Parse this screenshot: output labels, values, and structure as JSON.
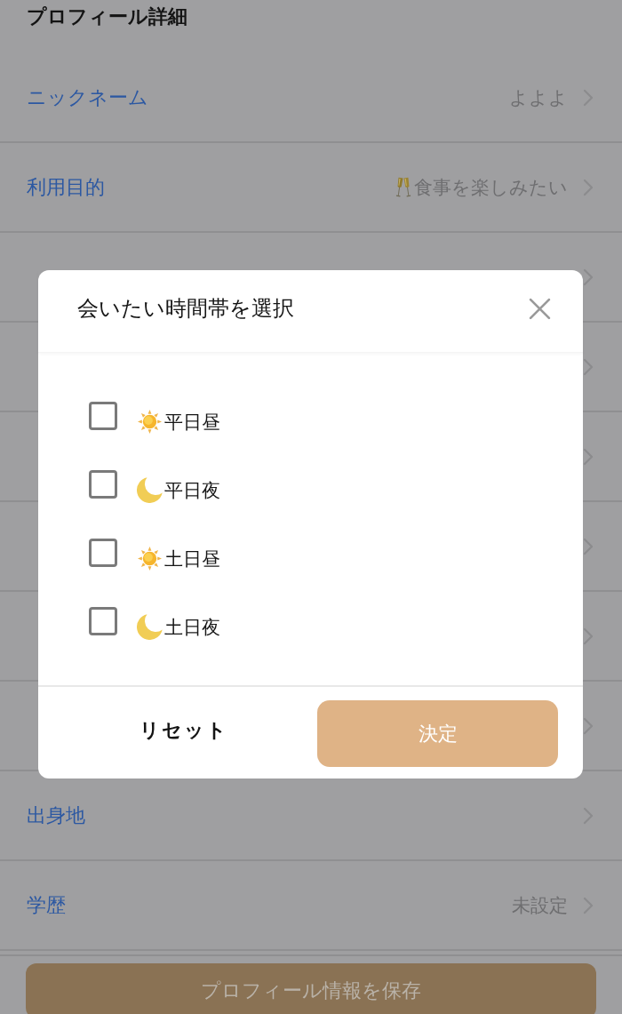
{
  "header": {
    "title": "プロフィール詳細"
  },
  "rows": [
    {
      "label": "ニックネーム",
      "value": "よよよ",
      "kind": "plain"
    },
    {
      "label": "利用目的",
      "value": "食事を楽しみたい",
      "kind": "emoji"
    },
    {
      "kind": "plain"
    },
    {
      "kind": "plain"
    },
    {
      "kind": "plain"
    },
    {
      "kind": "plain"
    },
    {
      "kind": "plain"
    },
    {
      "kind": "plain"
    },
    {
      "label": "出身地",
      "kind": "plain"
    },
    {
      "label": "学歴",
      "value": "未設定",
      "kind": "plain"
    }
  ],
  "save_button": {
    "label": "プロフィール情報を保存"
  },
  "dialog": {
    "title": "会いたい時間帯を選択",
    "options": [
      {
        "label": "平日昼",
        "kind": "day",
        "checked": false
      },
      {
        "label": "平日夜",
        "kind": "night",
        "checked": false
      },
      {
        "label": "土日昼",
        "kind": "day",
        "checked": false
      },
      {
        "label": "土日夜",
        "kind": "night",
        "checked": false
      }
    ],
    "reset_button": "リセット",
    "confirm_button": "決定"
  }
}
